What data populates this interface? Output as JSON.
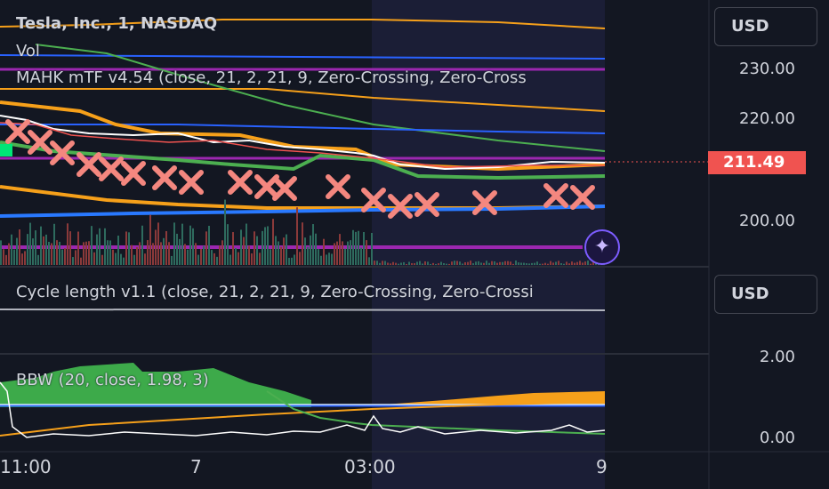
{
  "symbol_legend": {
    "title": "Tesla, Inc., 1, NASDAQ"
  },
  "indicators": {
    "vol": "Vol",
    "mahk": "MAHK mTF v4.54 (close, 21, 2, 21, 9, Zero-Crossing, Zero-Cross",
    "cycle": "Cycle length v1.1 (close, 21, 2, 21, 9, Zero-Crossing, Zero-Crossi",
    "bbw": "BBW (20, close, 1.98, 3)"
  },
  "price_scale": {
    "currency": "USD",
    "labels": [
      "230.00",
      "220.00",
      "200.00"
    ],
    "current_price": "211.49"
  },
  "cycle_scale": {
    "currency": "USD"
  },
  "bbw_scale": {
    "labels": [
      "2.00",
      "0.00"
    ]
  },
  "time_axis": {
    "labels": [
      "11:00",
      "7",
      "03:00",
      "9"
    ]
  },
  "colors": {
    "background": "#131722",
    "highlight_session": "#1c1f38",
    "price_line_up": "#f05350",
    "cross_markers": "#f4877f",
    "orange": "#f6a01a",
    "green": "#4caf50",
    "blue": "#2962ff",
    "purple": "#9c27b0",
    "white": "#ffffff"
  },
  "icons": {
    "assistant": "sparkle-icon"
  }
}
